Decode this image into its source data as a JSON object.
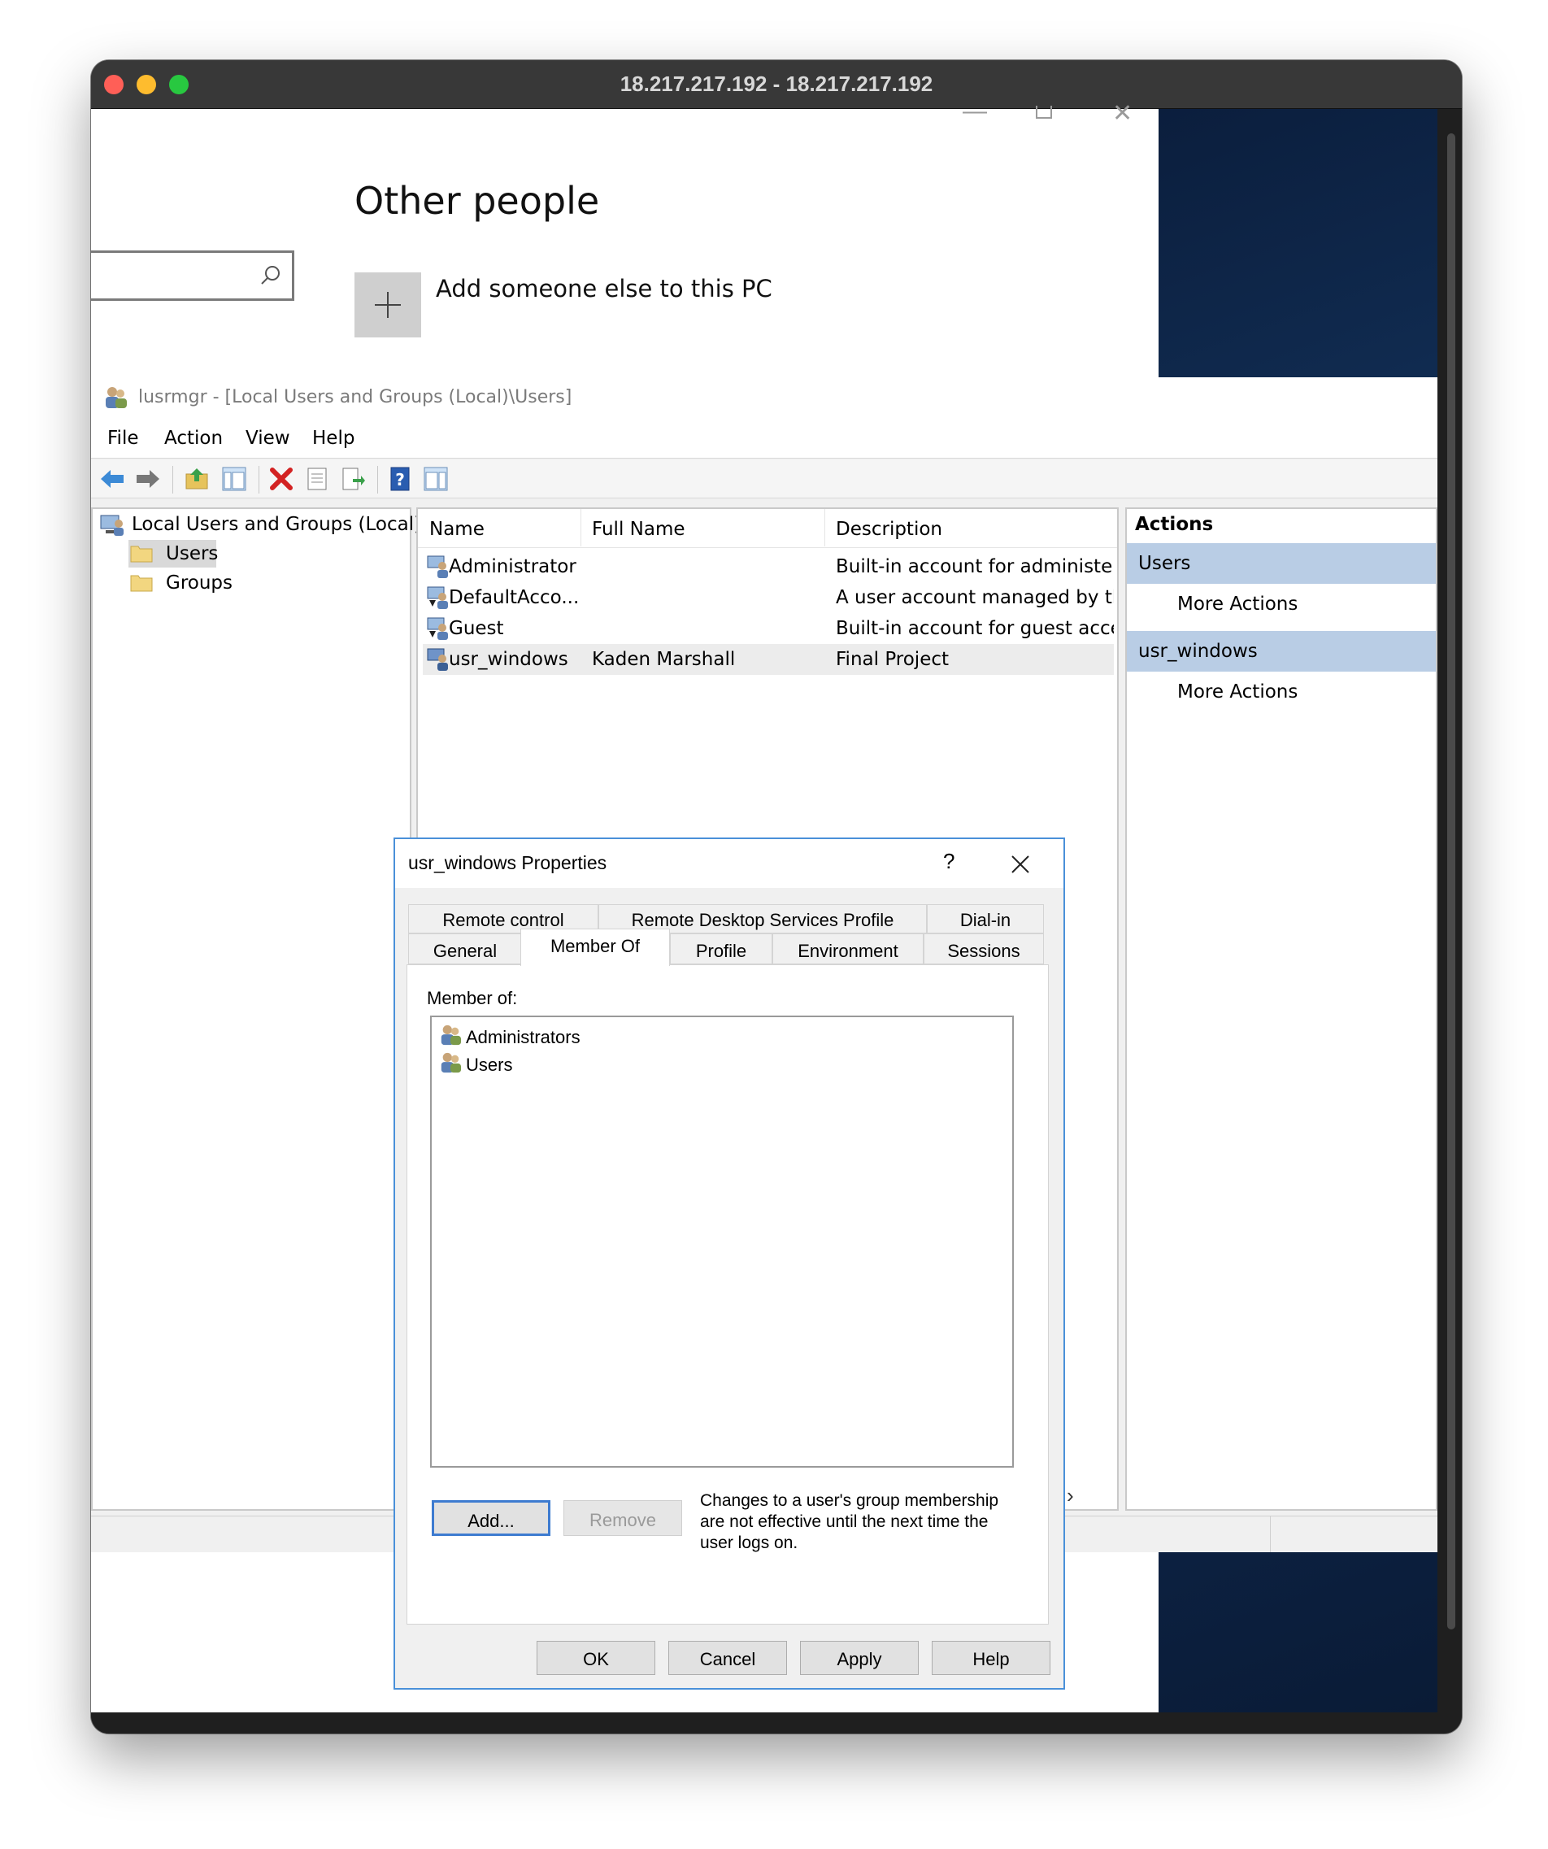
{
  "mac_window": {
    "title": "18.217.217.192 - 18.217.217.192",
    "traffic_lights": {
      "close": "#ff5f57",
      "minimize": "#febc2e",
      "zoom": "#28c840"
    }
  },
  "settings": {
    "section_title": "Other people",
    "add_someone_label": "Add someone else to this PC",
    "search_icon": "search-icon",
    "plus_icon": "plus-icon"
  },
  "mmc": {
    "title": "lusrmgr - [Local Users and Groups (Local)\\Users]",
    "menu": [
      "File",
      "Action",
      "View",
      "Help"
    ],
    "toolbar_icons": [
      "back-arrow-icon",
      "forward-arrow-icon",
      "up-folder-icon",
      "show-hide-tree-icon",
      "delete-icon",
      "properties-icon",
      "export-list-icon",
      "help-icon",
      "show-hide-action-pane-icon"
    ],
    "tree": {
      "root": "Local Users and Groups (Local)",
      "children": [
        "Users",
        "Groups"
      ],
      "selected": "Users"
    },
    "list": {
      "columns": [
        "Name",
        "Full Name",
        "Description"
      ],
      "rows": [
        {
          "name": "Administrator",
          "full_name": "",
          "description": "Built-in account for administerin"
        },
        {
          "name": "DefaultAcco...",
          "full_name": "",
          "description": "A user account managed by the"
        },
        {
          "name": "Guest",
          "full_name": "",
          "description": "Built-in account for guest access"
        },
        {
          "name": "usr_windows",
          "full_name": "Kaden Marshall",
          "description": "Final Project"
        }
      ],
      "selected_row": "usr_windows"
    },
    "actions": {
      "header": "Actions",
      "groups": [
        {
          "title": "Users",
          "item": "More Actions"
        },
        {
          "title": "usr_windows",
          "item": "More Actions"
        }
      ]
    }
  },
  "dialog": {
    "title": "usr_windows Properties",
    "help_glyph": "?",
    "tabs_row1": [
      "Remote control",
      "Remote Desktop Services Profile",
      "Dial-in"
    ],
    "tabs_row2": [
      "General",
      "Member Of",
      "Profile",
      "Environment",
      "Sessions"
    ],
    "active_tab": "Member Of",
    "member_of_label": "Member of:",
    "groups": [
      "Administrators",
      "Users"
    ],
    "add_button": "Add...",
    "remove_button": "Remove",
    "note": [
      "Changes to a user's group membership",
      "are not effective until the next time the",
      "user logs on."
    ],
    "ok_button": "OK",
    "cancel_button": "Cancel",
    "apply_button": "Apply",
    "help_button": "Help",
    "accent_color": "#4a90d9"
  }
}
